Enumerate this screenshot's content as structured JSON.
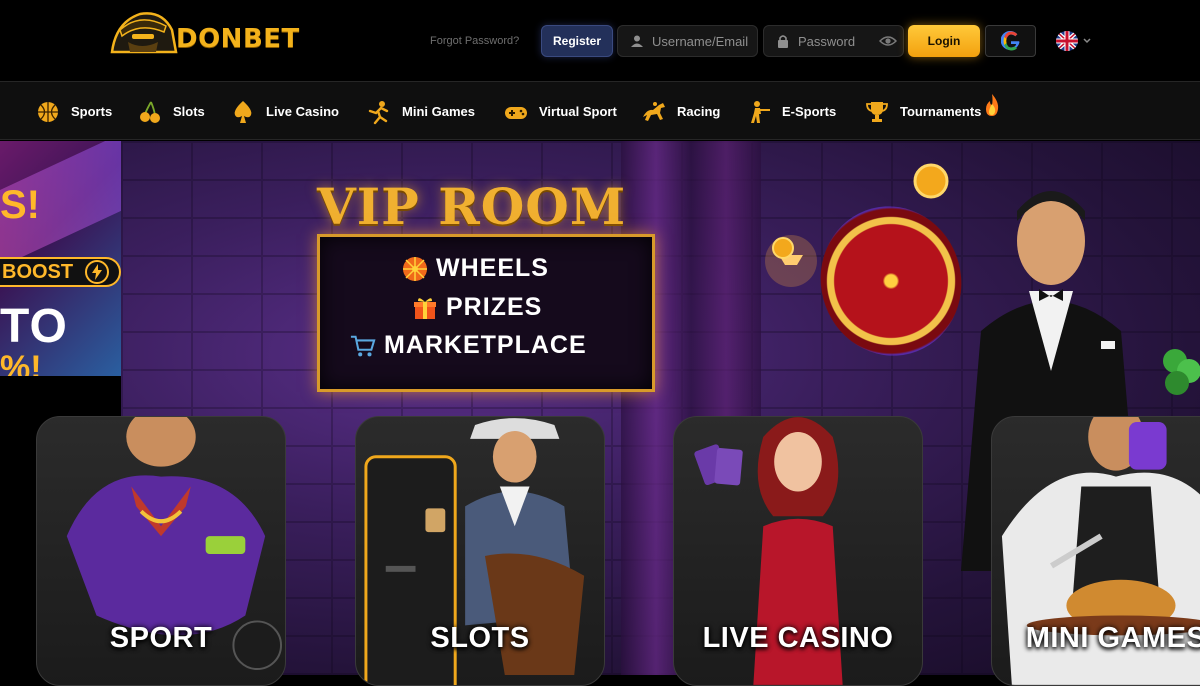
{
  "brand": {
    "name": "DONBET"
  },
  "header": {
    "forgot_password": "Forgot Password?",
    "register_label": "Register",
    "username_placeholder": "Username/Email",
    "password_placeholder": "Password",
    "login_label": "Login",
    "google_icon": "google-icon",
    "language_icon": "uk-flag-icon"
  },
  "nav": {
    "items": [
      {
        "label": "Sports",
        "icon": "basketball-icon"
      },
      {
        "label": "Slots",
        "icon": "cherries-icon"
      },
      {
        "label": "Live Casino",
        "icon": "spade-icon"
      },
      {
        "label": "Mini Games",
        "icon": "joystick-figure-icon"
      },
      {
        "label": "Virtual Sport",
        "icon": "gamepad-icon"
      },
      {
        "label": "Racing",
        "icon": "horse-racing-icon"
      },
      {
        "label": "E-Sports",
        "icon": "soldier-icon"
      },
      {
        "label": "Tournaments",
        "icon": "trophy-icon"
      }
    ],
    "hot_icon": "fire-icon"
  },
  "promo_left": {
    "boost": "BOOST",
    "to": "TO",
    "percent": "%!",
    "top_excl": "S!"
  },
  "banner": {
    "title": "VIP ROOM",
    "lines": [
      {
        "text": "WHEELS",
        "icon": "wheel-icon"
      },
      {
        "text": "PRIZES",
        "icon": "gift-icon"
      },
      {
        "text": "MARKETPLACE",
        "icon": "cart-icon"
      }
    ]
  },
  "categories": [
    {
      "label": "SPORT"
    },
    {
      "label": "SLOTS"
    },
    {
      "label": "LIVE CASINO"
    },
    {
      "label": "MINI GAMES"
    }
  ],
  "colors": {
    "accent": "#f3b21b",
    "register_bg": "#23305a",
    "login_bg": "#ffc93a"
  }
}
